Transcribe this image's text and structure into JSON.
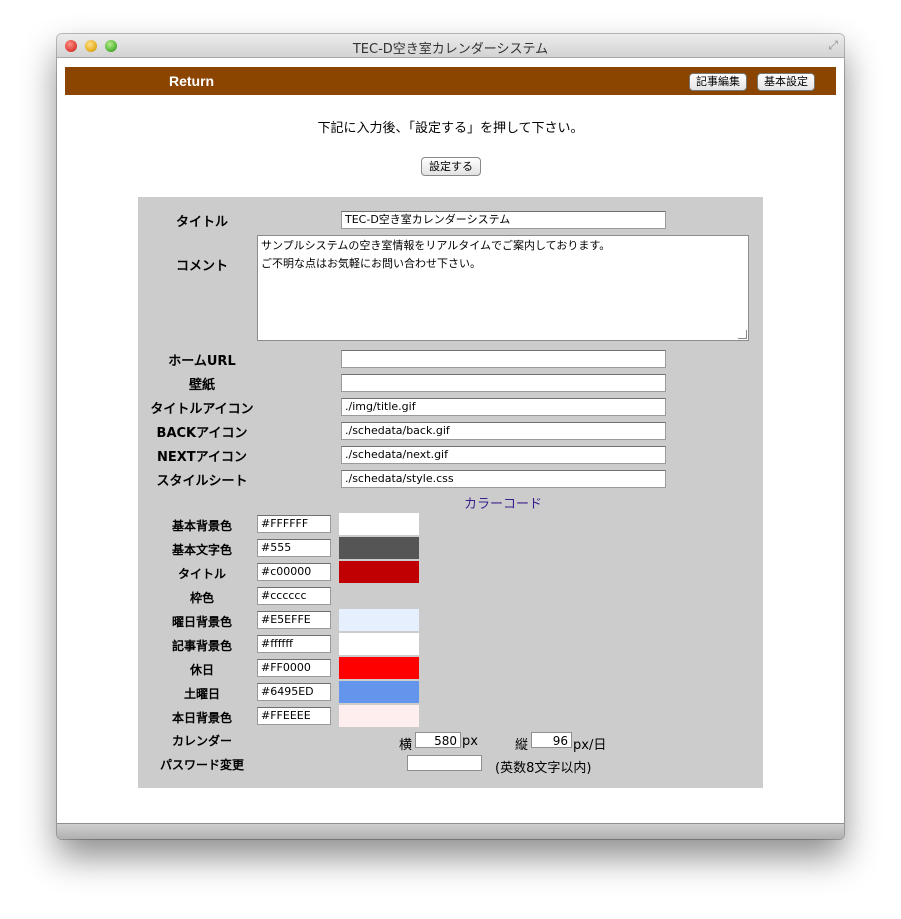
{
  "window": {
    "title": "TEC-D空き室カレンダーシステム"
  },
  "nav": {
    "return_label": "Return",
    "edit_button": "記事編集",
    "basic_button": "基本設定",
    "bg_color": "#8B4500"
  },
  "instruction": "下記に入力後、「設定する」を押して下さい。",
  "submit_button": "設定する",
  "form": {
    "title_label": "タイトル",
    "title_value": "TEC-D空き室カレンダーシステム",
    "comment_label": "コメント",
    "comment_line1": "サンプルシステムの空き室情報をリアルタイムでご案内しております。",
    "comment_line2": "ご不明な点はお気軽にお問い合わせ下さい。",
    "homeurl_label": "ホームURL",
    "homeurl_value": "",
    "wallpaper_label": "壁紙",
    "wallpaper_value": "",
    "titleicon_label": "タイトルアイコン",
    "titleicon_value": "./img/title.gif",
    "backicon_label": "BACKアイコン",
    "backicon_value": "./schedata/back.gif",
    "nexticon_label": "NEXTアイコン",
    "nexticon_value": "./schedata/next.gif",
    "stylesheet_label": "スタイルシート",
    "stylesheet_value": "./schedata/style.css",
    "color_heading": "カラーコード",
    "colors": [
      {
        "label": "基本背景色",
        "value": "#FFFFFF",
        "swatch": "#FFFFFF"
      },
      {
        "label": "基本文字色",
        "value": "#555",
        "swatch": "#555555"
      },
      {
        "label": "タイトル",
        "value": "#c00000",
        "swatch": "#C00000"
      },
      {
        "label": "枠色",
        "value": "#cccccc",
        "swatch": "#CCCCCC"
      },
      {
        "label": "曜日背景色",
        "value": "#E5EFFE",
        "swatch": "#E5EFFE"
      },
      {
        "label": "記事背景色",
        "value": "#ffffff",
        "swatch": "#FFFFFF"
      },
      {
        "label": "休日",
        "value": "#FF0000",
        "swatch": "#FF0000"
      },
      {
        "label": "土曜日",
        "value": "#6495ED",
        "swatch": "#6495ED"
      },
      {
        "label": "本日背景色",
        "value": "#FFEEEE",
        "swatch": "#FFEEEE"
      }
    ],
    "calendar_label": "カレンダー",
    "cal_width_label": "横",
    "cal_width_value": "580",
    "cal_width_unit": "px",
    "cal_height_label": "縦",
    "cal_height_value": "96",
    "cal_height_unit": "px/日",
    "password_label": "パスワード変更",
    "password_value": "",
    "password_hint": "(英数8文字以内)"
  }
}
